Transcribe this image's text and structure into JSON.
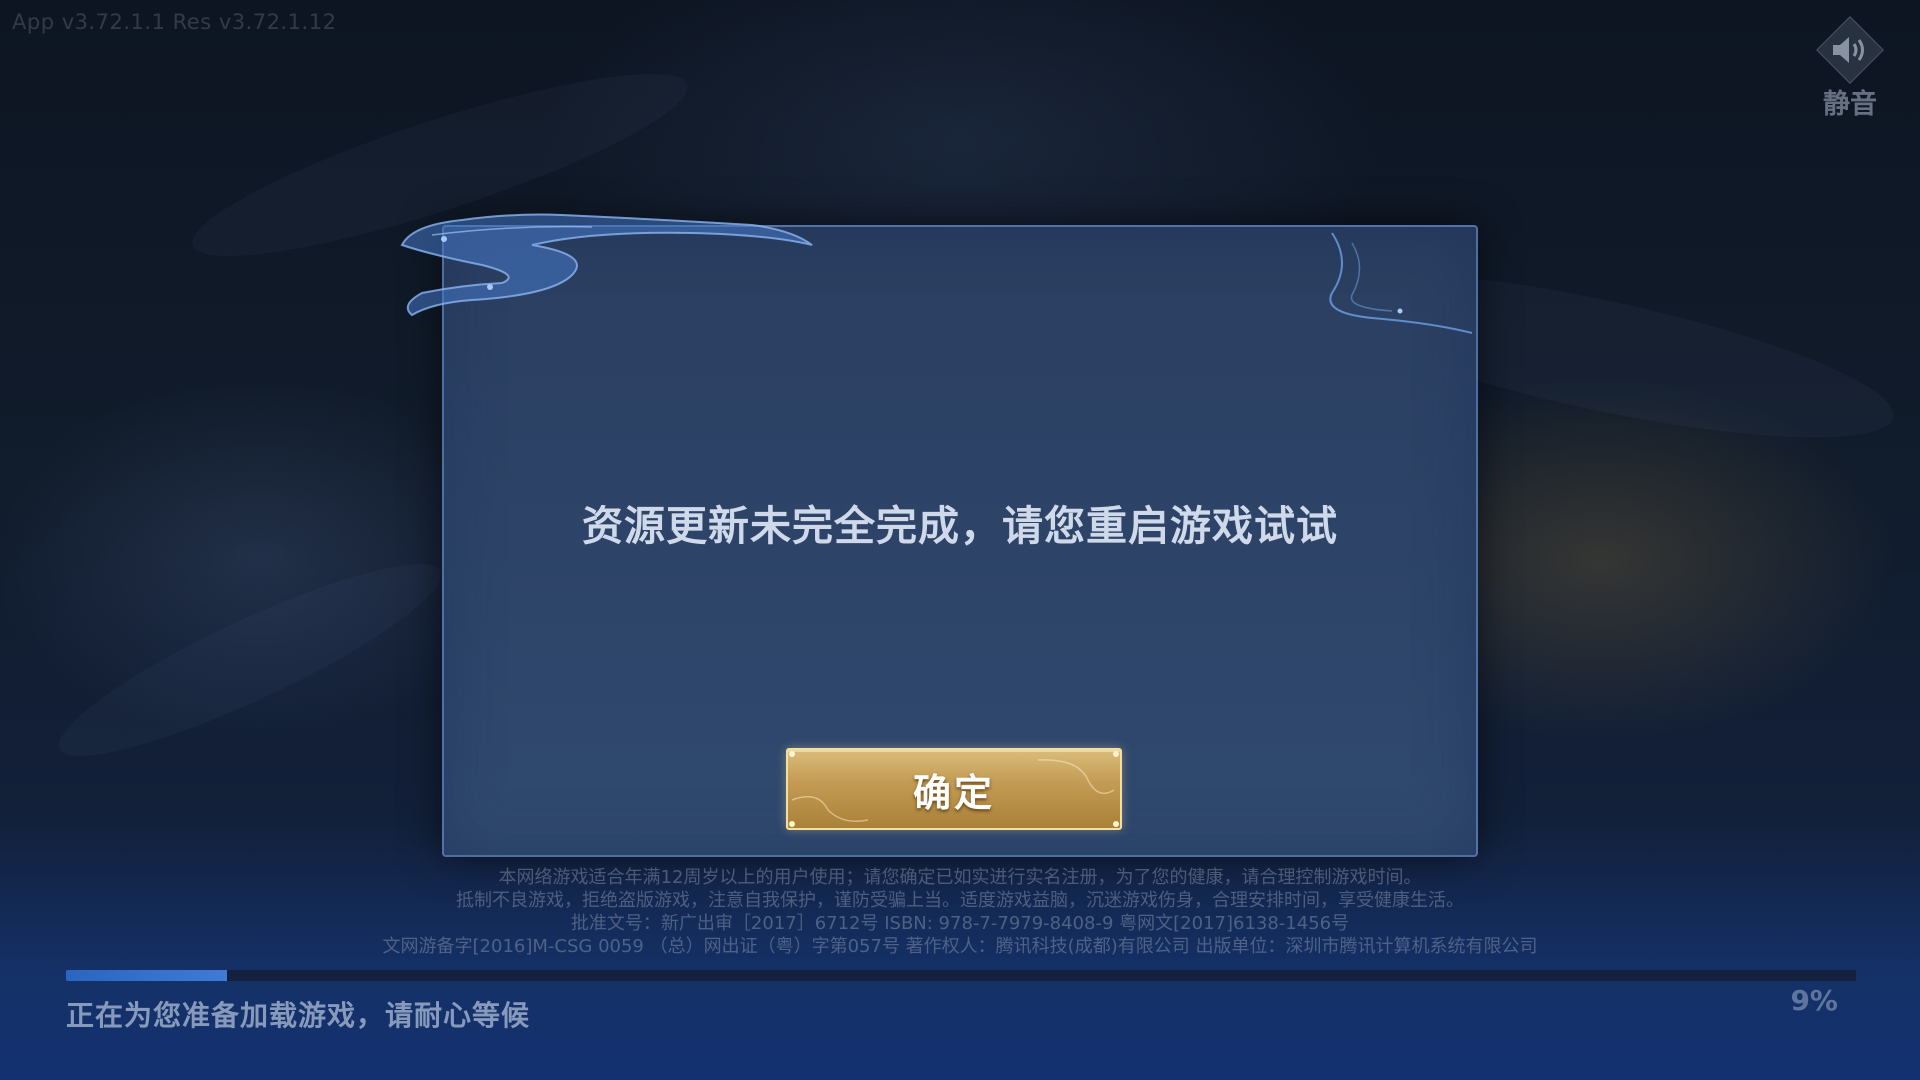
{
  "version": {
    "text": "App v3.72.1.1   Res v3.72.1.12"
  },
  "mute": {
    "label": "静音",
    "icon": "speaker-icon"
  },
  "dialog": {
    "message": "资源更新未完全完成，请您重启游戏试试",
    "confirm_label": "确定"
  },
  "disclaimer": {
    "lines": [
      "本网络游戏适合年满12周岁以上的用户使用；请您确定已如实进行实名注册，为了您的健康，请合理控制游戏时间。",
      "抵制不良游戏，拒绝盗版游戏，注意自我保护，谨防受骗上当。适度游戏益脑，沉迷游戏伤身，合理安排时间，享受健康生活。",
      "批准文号：新广出审［2017］6712号  ISBN: 978-7-7979-8408-9  粤网文[2017]6138-1456号",
      "文网游备字[2016]M-CSG 0059  （总）网出证（粤）字第057号  著作权人：腾讯科技(成都)有限公司  出版单位：深圳市腾讯计算机系统有限公司"
    ]
  },
  "loading": {
    "status_text": "正在为您准备加载游戏，请耐心等候",
    "percent_text": "9%",
    "progress_fraction": 0.09
  },
  "colors": {
    "accent_gold": "#c49c55",
    "progress_blue": "#2a66c0",
    "dialog_bg": "#2d4468"
  }
}
